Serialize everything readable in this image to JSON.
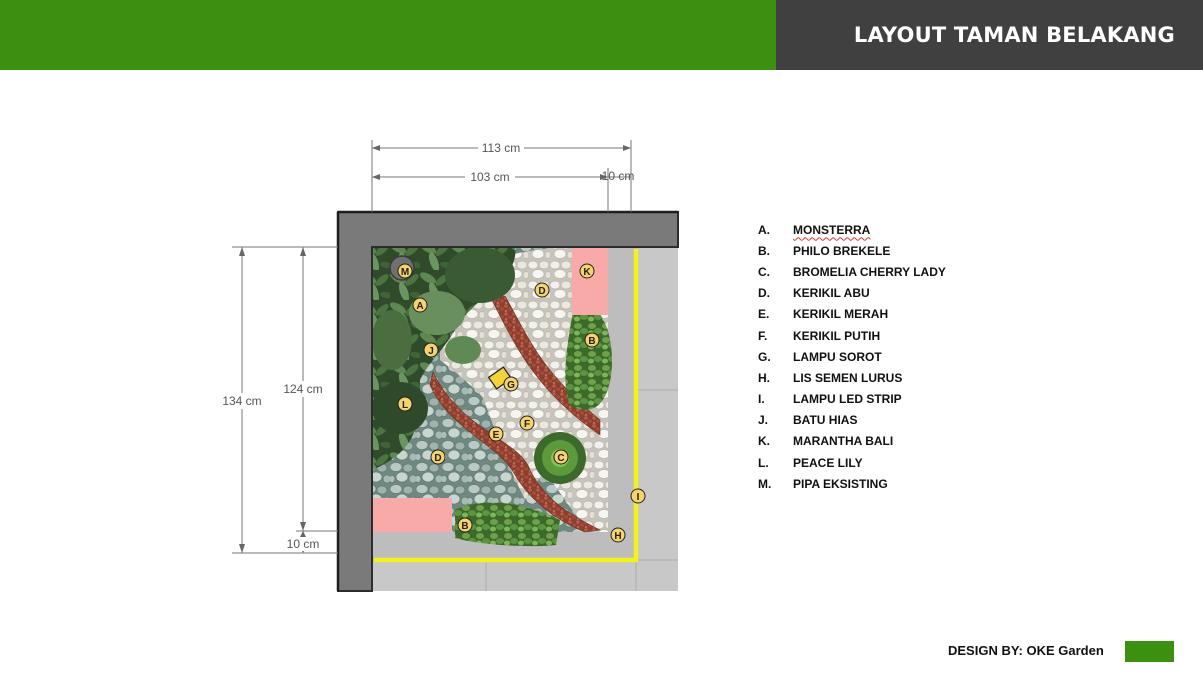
{
  "header": {
    "title": "LAYOUT TAMAN BELAKANG",
    "green": "#3c9010",
    "dark": "#404040"
  },
  "dimensions": {
    "top_total": "113 cm",
    "top_inner": "103 cm",
    "top_right": "10 cm",
    "left_total": "134 cm",
    "left_inner": "124 cm",
    "left_bottom": "10 cm"
  },
  "markers": {
    "m1": "M",
    "a1": "A",
    "a2": "J",
    "l1": "L",
    "d1": "D",
    "d2": "D",
    "k1": "K",
    "b1": "B",
    "b2": "B",
    "g1": "G",
    "e1": "E",
    "f1": "F",
    "c1": "C",
    "i1": "I",
    "h1": "H"
  },
  "legend": [
    {
      "letter": "A.",
      "name": "MONSTERRA"
    },
    {
      "letter": "B.",
      "name": "PHILO BREKELE"
    },
    {
      "letter": "C.",
      "name": "BROMELIA CHERRY LADY"
    },
    {
      "letter": "D.",
      "name": "KERIKIL ABU"
    },
    {
      "letter": "E.",
      "name": "KERIKIL MERAH"
    },
    {
      "letter": "F.",
      "name": "KERIKIL PUTIH"
    },
    {
      "letter": "G.",
      "name": "LAMPU SOROT"
    },
    {
      "letter": "H.",
      "name": "LIS SEMEN LURUS"
    },
    {
      "letter": "I.",
      "name": "LAMPU LED STRIP"
    },
    {
      "letter": "J.",
      "name": "BATU HIAS"
    },
    {
      "letter": "K.",
      "name": "MARANTHA BALI"
    },
    {
      "letter": "L.",
      "name": "PEACE LILY"
    },
    {
      "letter": "M.",
      "name": "PIPA EKSISTING"
    }
  ],
  "footer": {
    "credit": "DESIGN BY: OKE Garden",
    "swatch": "#3c9010"
  }
}
